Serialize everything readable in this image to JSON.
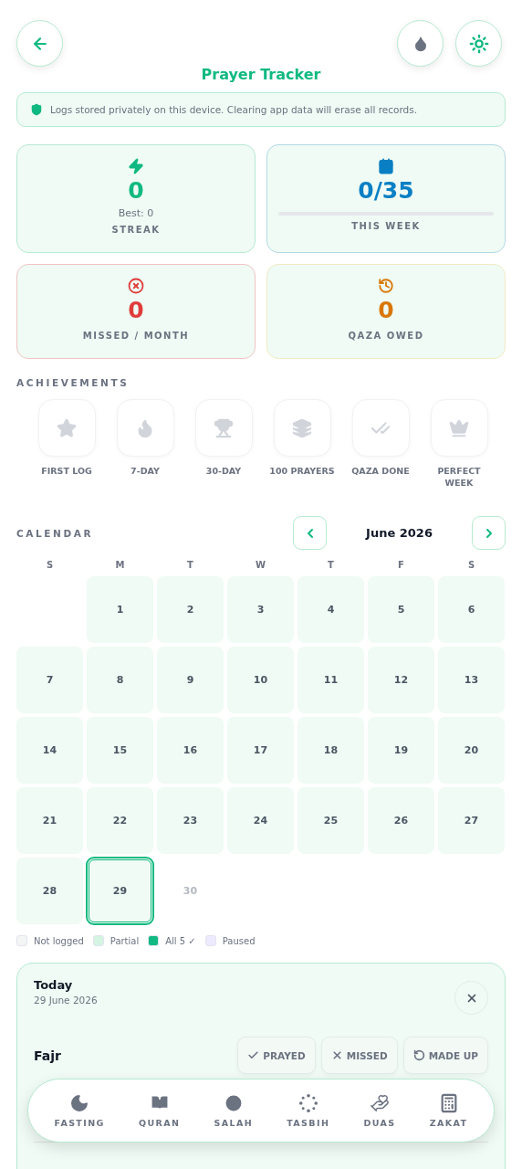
{
  "header": {
    "title": "Prayer Tracker"
  },
  "notice": {
    "text": "Logs stored privately on this device. Clearing app data will erase all records."
  },
  "stats": [
    {
      "kind": "streak",
      "value": "0",
      "sub": "Best: 0",
      "label": "STREAK"
    },
    {
      "kind": "week",
      "value": "0/35",
      "level": 0,
      "label": "THIS WEEK"
    },
    {
      "kind": "missed",
      "value": "0",
      "label": "MISSED / MONTH"
    },
    {
      "kind": "qaza",
      "value": "0",
      "label": "QAZA OWED"
    }
  ],
  "achievements": {
    "title": "ACHIEVEMENTS",
    "items": [
      {
        "kind": "star",
        "label": "FIRST LOG",
        "unlocked": false
      },
      {
        "kind": "flame",
        "label": "7-DAY",
        "unlocked": false
      },
      {
        "kind": "trophy",
        "label": "30-DAY",
        "unlocked": false
      },
      {
        "kind": "layers",
        "label": "100 PRAYERS",
        "unlocked": false
      },
      {
        "kind": "checks",
        "label": "QAZA DONE",
        "unlocked": false
      },
      {
        "kind": "crown",
        "label": "PERFECT WEEK",
        "unlocked": false
      }
    ]
  },
  "calendar": {
    "title": "CALENDAR",
    "month": "June 2026",
    "weekdays": [
      "S",
      "M",
      "T",
      "W",
      "T",
      "F",
      "S"
    ],
    "days": [
      {
        "label": "1",
        "selected": false,
        "disabled": false
      },
      {
        "label": "2",
        "selected": false,
        "disabled": false
      },
      {
        "label": "3",
        "selected": false,
        "disabled": false
      },
      {
        "label": "4",
        "selected": false,
        "disabled": false
      },
      {
        "label": "5",
        "selected": false,
        "disabled": false
      },
      {
        "label": "6",
        "selected": false,
        "disabled": false
      },
      {
        "label": "7",
        "selected": false,
        "disabled": false
      },
      {
        "label": "8",
        "selected": false,
        "disabled": false
      },
      {
        "label": "9",
        "selected": false,
        "disabled": false
      },
      {
        "label": "10",
        "selected": false,
        "disabled": false
      },
      {
        "label": "11",
        "selected": false,
        "disabled": false
      },
      {
        "label": "12",
        "selected": false,
        "disabled": false
      },
      {
        "label": "13",
        "selected": false,
        "disabled": false
      },
      {
        "label": "14",
        "selected": false,
        "disabled": false
      },
      {
        "label": "15",
        "selected": false,
        "disabled": false
      },
      {
        "label": "16",
        "selected": false,
        "disabled": false
      },
      {
        "label": "17",
        "selected": false,
        "disabled": false
      },
      {
        "label": "18",
        "selected": false,
        "disabled": false
      },
      {
        "label": "19",
        "selected": false,
        "disabled": false
      },
      {
        "label": "20",
        "selected": false,
        "disabled": false
      },
      {
        "label": "21",
        "selected": false,
        "disabled": false
      },
      {
        "label": "22",
        "selected": false,
        "disabled": false
      },
      {
        "label": "23",
        "selected": false,
        "disabled": false
      },
      {
        "label": "24",
        "selected": false,
        "disabled": false
      },
      {
        "label": "25",
        "selected": false,
        "disabled": false
      },
      {
        "label": "26",
        "selected": false,
        "disabled": false
      },
      {
        "label": "27",
        "selected": false,
        "disabled": false
      },
      {
        "label": "28",
        "selected": false,
        "disabled": false
      },
      {
        "label": "29",
        "selected": true,
        "disabled": false
      },
      {
        "label": "30",
        "selected": false,
        "disabled": true
      }
    ],
    "legend": [
      {
        "label": "Not logged",
        "color": "#f3f6f5"
      },
      {
        "label": "Partial",
        "color": "#d3f5e2"
      },
      {
        "label": "All 5 ✓",
        "color": "#10b981"
      },
      {
        "label": "Paused",
        "color": "#ede9fe"
      }
    ]
  },
  "day_panel": {
    "title": "Today",
    "date": "29 June 2026",
    "prayers": [
      {
        "name": "Fajr",
        "actions": [
          {
            "kind": "prayed",
            "label": "PRAYED"
          },
          {
            "kind": "missed",
            "label": "MISSED"
          },
          {
            "kind": "made_up",
            "label": "MADE UP"
          }
        ]
      }
    ]
  },
  "bottom_nav": [
    {
      "kind": "moon",
      "label": "FASTING"
    },
    {
      "kind": "book",
      "label": "QURAN"
    },
    {
      "kind": "clock",
      "label": "SALAH"
    },
    {
      "kind": "beads",
      "label": "TASBIH"
    },
    {
      "kind": "hand",
      "label": "DUAS"
    },
    {
      "kind": "calc",
      "label": "ZAKAT"
    }
  ]
}
